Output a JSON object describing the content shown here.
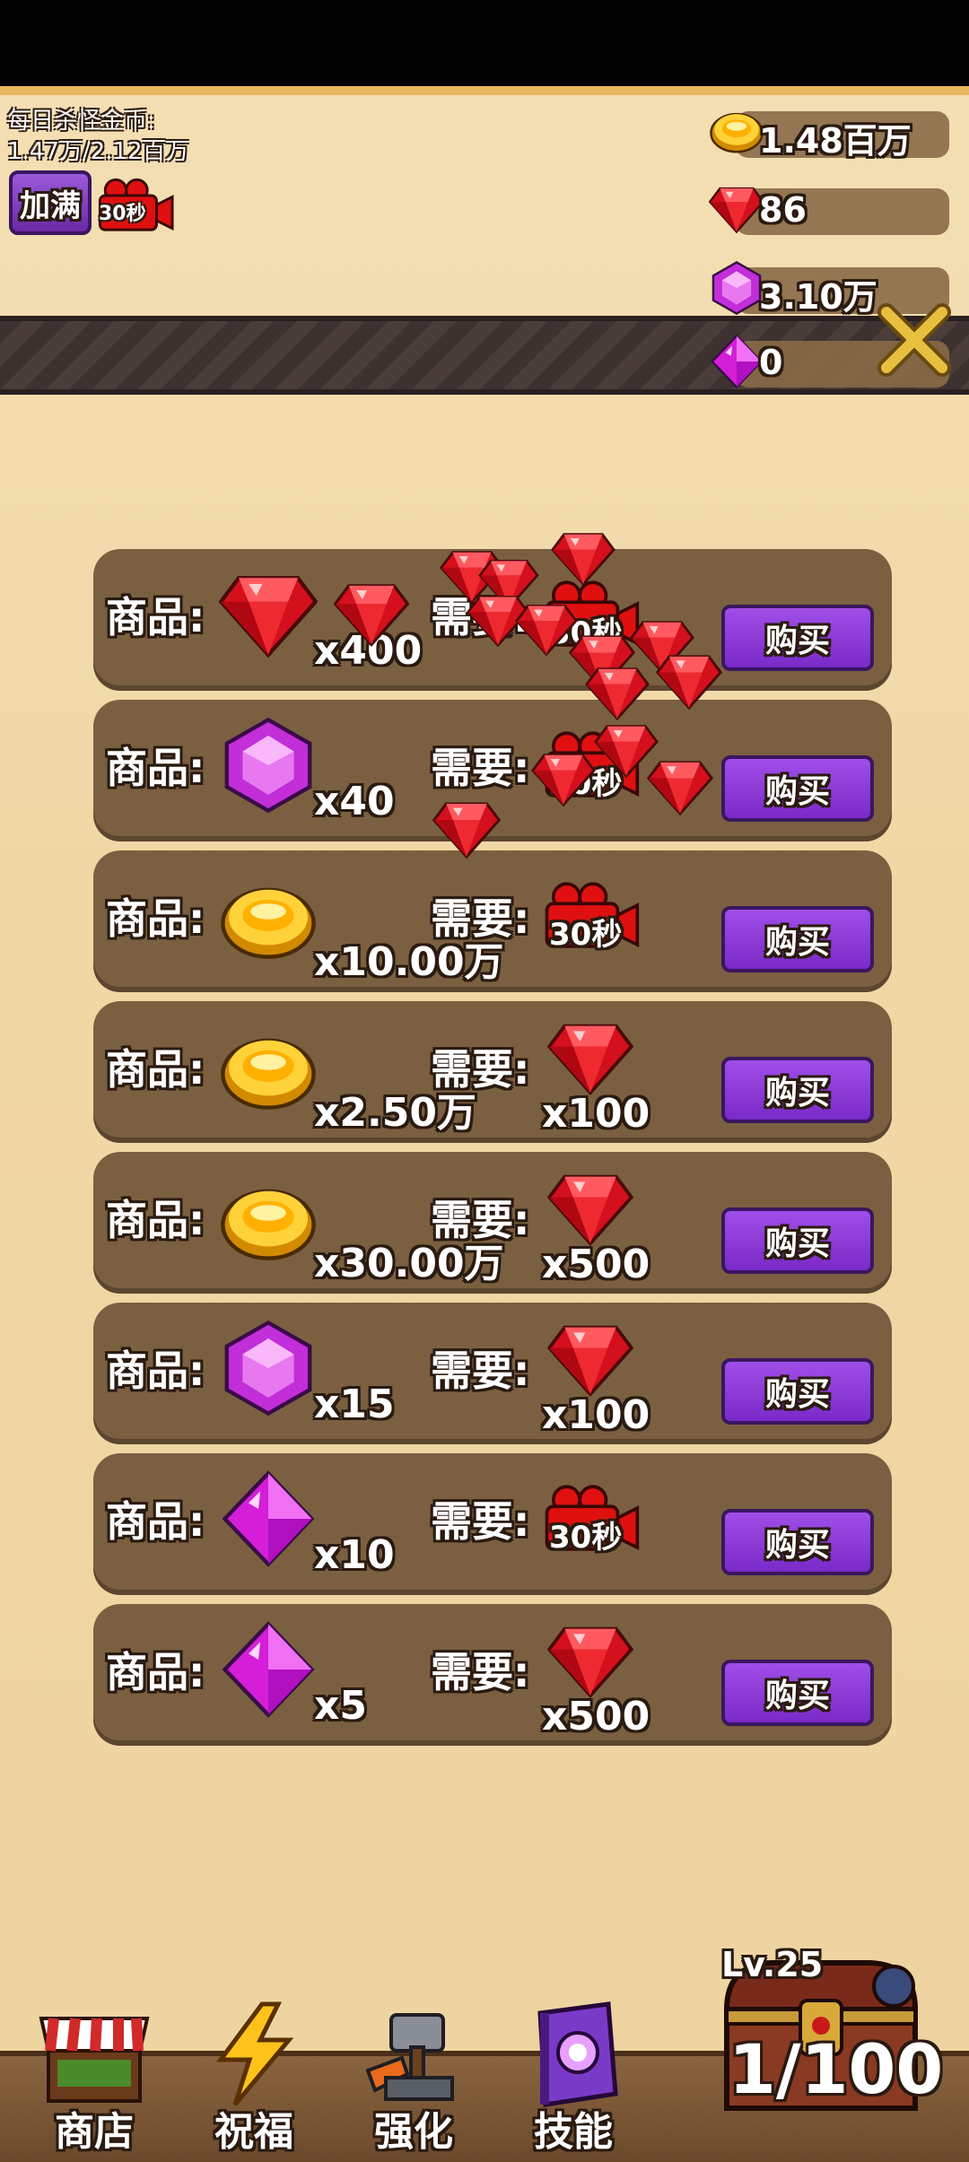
{
  "daily": {
    "label": "每日杀怪金币:",
    "value": "1.47万/2.12百万"
  },
  "fill_button": {
    "label": "加满"
  },
  "video_small": {
    "label": "30秒"
  },
  "currencies": [
    {
      "icon": "gold-coin",
      "value": "1.48百万"
    },
    {
      "icon": "red-ruby",
      "value": "86"
    },
    {
      "icon": "purple-hexagon-gem",
      "value": "3.10万"
    },
    {
      "icon": "pink-diamond",
      "value": "0"
    }
  ],
  "shop": {
    "item_label": "商品:",
    "cost_label": "需要:",
    "buy_label": "购买",
    "rows": [
      {
        "item_icon": "red-ruby",
        "item_qty": "x400",
        "cost_type": "video",
        "cost_label": "30秒",
        "cost_qty": ""
      },
      {
        "item_icon": "purple-hexagon-gem",
        "item_qty": "x40",
        "cost_type": "video",
        "cost_label": "30秒",
        "cost_qty": ""
      },
      {
        "item_icon": "gold-coin",
        "item_qty": "x10.00万",
        "cost_type": "video",
        "cost_label": "30秒",
        "cost_qty": ""
      },
      {
        "item_icon": "gold-coin",
        "item_qty": "x2.50万",
        "cost_type": "ruby",
        "cost_label": "",
        "cost_qty": "x100"
      },
      {
        "item_icon": "gold-coin",
        "item_qty": "x30.00万",
        "cost_type": "ruby",
        "cost_label": "",
        "cost_qty": "x500"
      },
      {
        "item_icon": "purple-hexagon-gem",
        "item_qty": "x15",
        "cost_type": "ruby",
        "cost_label": "",
        "cost_qty": "x100"
      },
      {
        "item_icon": "pink-diamond",
        "item_qty": "x10",
        "cost_type": "video",
        "cost_label": "30秒",
        "cost_qty": ""
      },
      {
        "item_icon": "pink-diamond",
        "item_qty": "x5",
        "cost_type": "ruby",
        "cost_label": "",
        "cost_qty": "x500"
      }
    ]
  },
  "nav": [
    {
      "label": "商店",
      "icon": "shop-stall"
    },
    {
      "label": "祝福",
      "icon": "lightning-bolt"
    },
    {
      "label": "强化",
      "icon": "anvil-hammer"
    },
    {
      "label": "技能",
      "icon": "spell-book"
    }
  ],
  "chest": {
    "level": "Lv.25",
    "capacity": "1/100"
  },
  "colors": {
    "buy": "#8a3ad8",
    "row": "#7a6040",
    "ruby": "#e0202a",
    "gold": "#f2b400"
  }
}
